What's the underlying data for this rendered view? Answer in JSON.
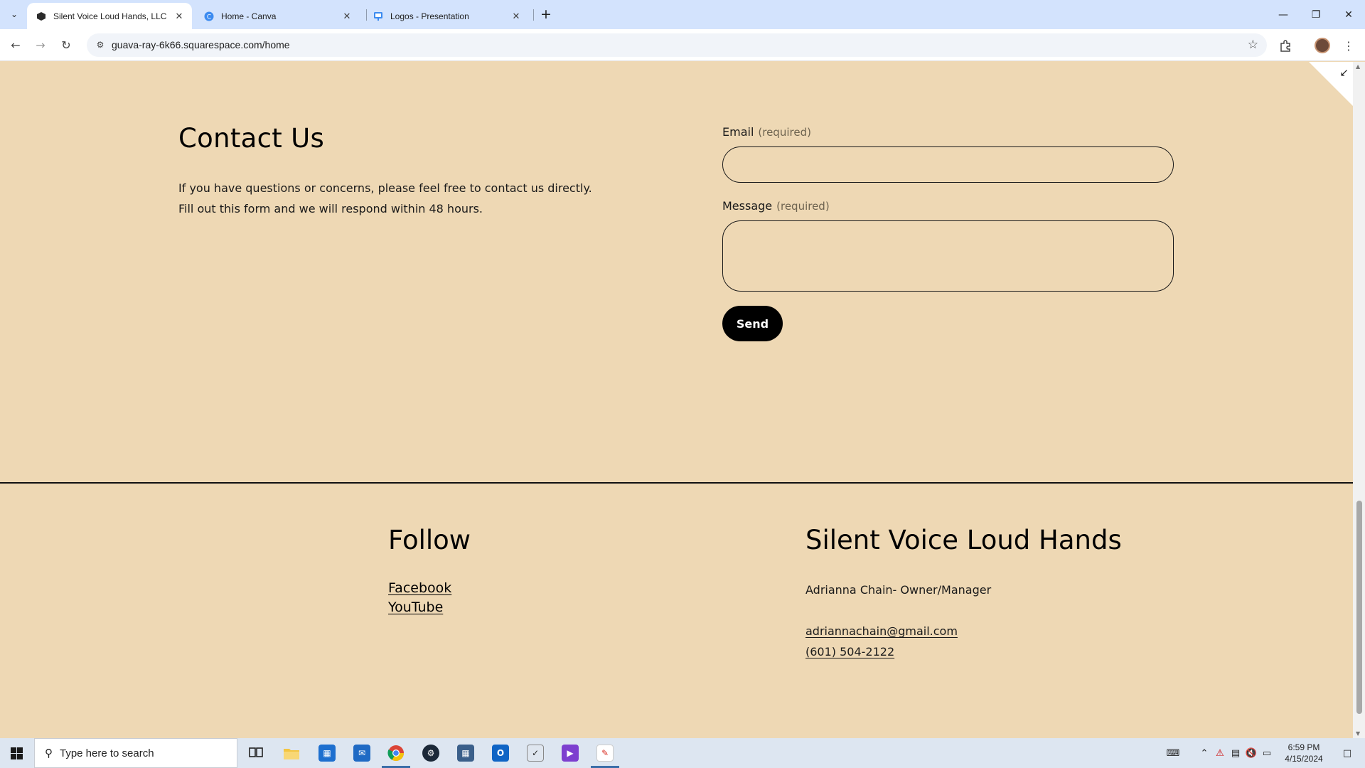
{
  "browser": {
    "tabs": [
      {
        "title": "Silent Voice Loud Hands, LLC",
        "active": true
      },
      {
        "title": "Home - Canva",
        "active": false
      },
      {
        "title": "Logos - Presentation",
        "active": false
      }
    ],
    "url": "guava-ray-6k66.squarespace.com/home"
  },
  "contact": {
    "title": "Contact Us",
    "desc_line1": "If you have questions or concerns, please feel free to contact us directly.",
    "desc_line2": "Fill out this form and we will respond within 48 hours.",
    "email_label": "Email",
    "email_req": "(required)",
    "message_label": "Message",
    "message_req": "(required)",
    "email_value": "",
    "message_value": "",
    "send_label": "Send"
  },
  "footer": {
    "follow_title": "Follow",
    "links": [
      "Facebook",
      "YouTube"
    ],
    "brand_title": "Silent Voice Loud Hands",
    "owner": "Adrianna Chain- Owner/Manager",
    "email": "adriannachain@gmail.com",
    "phone": "(601) 504-2122"
  },
  "taskbar": {
    "search_placeholder": "Type here to search",
    "time": "6:59 PM",
    "date": "4/15/2024",
    "apps": [
      "task-view",
      "file-explorer",
      "microsoft-store",
      "mail",
      "chrome",
      "steam",
      "calculator",
      "outlook",
      "clock-app",
      "clipchamp",
      "paint-app"
    ]
  },
  "colors": {
    "page_bg": "#eed8b4",
    "tabstrip_bg": "#d3e3fd",
    "button_bg": "#000000"
  }
}
